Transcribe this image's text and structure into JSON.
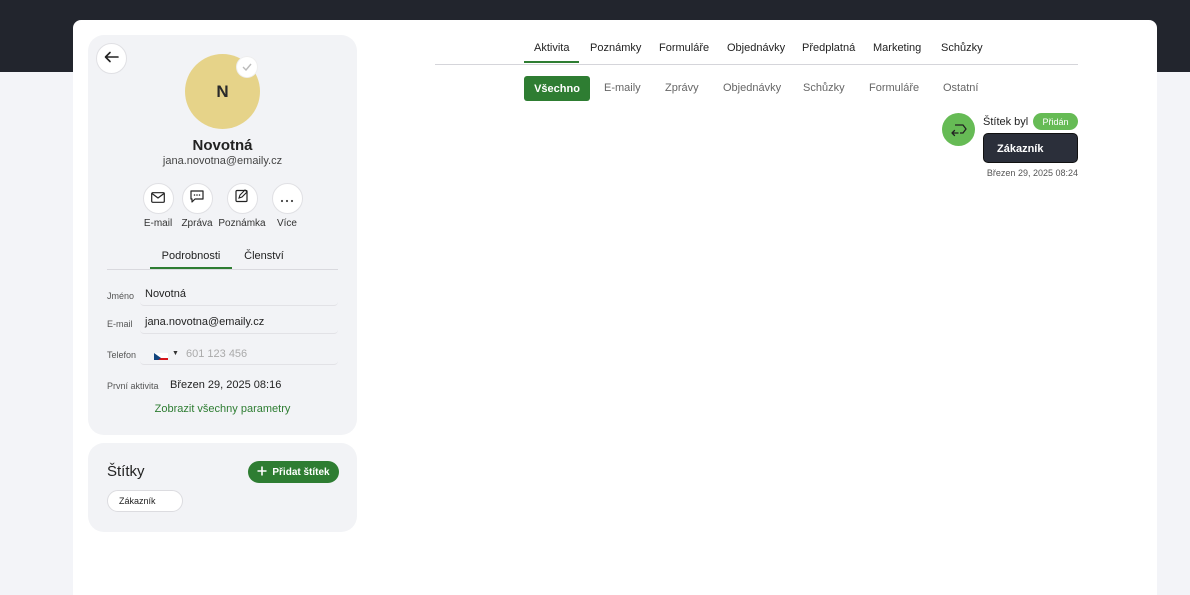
{
  "profile": {
    "avatar_initial": "N",
    "name": "Novotná",
    "email": "jana.novotna@emaily.cz",
    "actions": [
      {
        "label": "E-mail",
        "icon": "mail-icon"
      },
      {
        "label": "Zpráva",
        "icon": "message-icon"
      },
      {
        "label": "Poznámka",
        "icon": "note-icon"
      },
      {
        "label": "Více",
        "icon": "more-icon"
      }
    ],
    "tabs": [
      {
        "label": "Podrobnosti",
        "active": true
      },
      {
        "label": "Členství",
        "active": false
      }
    ],
    "fields": {
      "name_label": "Jméno",
      "name_value": "Novotná",
      "email_label": "E-mail",
      "email_value": "jana.novotna@emaily.cz",
      "phone_label": "Telefon",
      "phone_placeholder": "601 123 456",
      "phone_country_icon": "czech-flag-icon",
      "first_activity_label": "První aktivita",
      "first_activity_value": "Březen 29, 2025 08:16"
    },
    "show_all_link": "Zobrazit všechny parametry"
  },
  "tags": {
    "title": "Štítky",
    "add_button": "Přidat štítek",
    "items": [
      "Zákazník"
    ]
  },
  "main_tabs": [
    {
      "label": "Aktivita",
      "active": true
    },
    {
      "label": "Poznámky",
      "active": false
    },
    {
      "label": "Formuláře",
      "active": false
    },
    {
      "label": "Objednávky",
      "active": false
    },
    {
      "label": "Předplatná",
      "active": false
    },
    {
      "label": "Marketing",
      "active": false
    },
    {
      "label": "Schůzky",
      "active": false
    }
  ],
  "sub_tabs": [
    {
      "label": "Všechno",
      "active": true
    },
    {
      "label": "E-maily",
      "active": false
    },
    {
      "label": "Zprávy",
      "active": false
    },
    {
      "label": "Objednávky",
      "active": false
    },
    {
      "label": "Schůzky",
      "active": false
    },
    {
      "label": "Formuláře",
      "active": false
    },
    {
      "label": "Ostatní",
      "active": false
    }
  ],
  "event": {
    "icon": "tag-arrow-icon",
    "text": "Štítek byl",
    "badge": "Přidán",
    "tag": "Zákazník",
    "timestamp": "Březen 29, 2025 08:24"
  },
  "colors": {
    "accent_green": "#2e7d32",
    "light_green": "#66bb55",
    "avatar_bg": "#e6d389",
    "dark": "#2b2f3a"
  }
}
